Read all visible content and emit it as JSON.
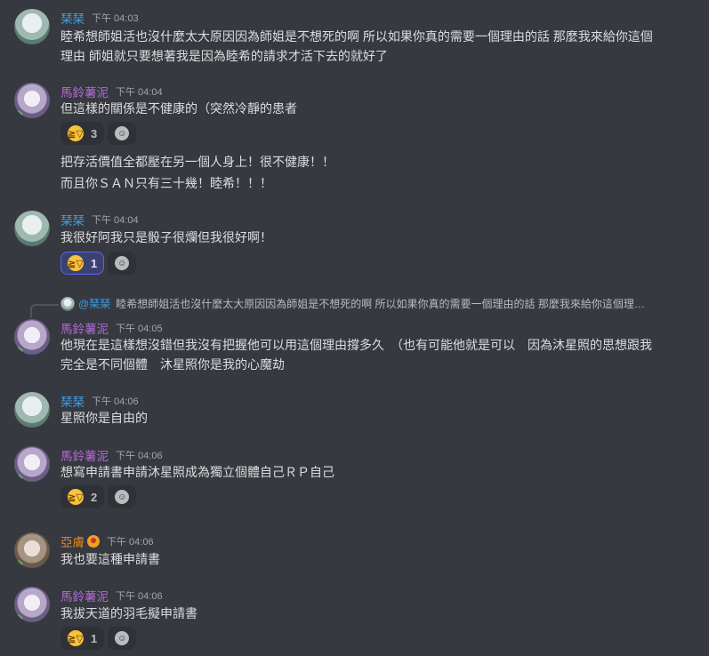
{
  "messages": [
    {
      "author": "琹琹",
      "time": "下午 04:03",
      "lines": [
        "睦希想師姐活也沒什麼太大原因因為師姐是不想死的啊 所以如果你真的需要一個理由的話 那麼我來給你這個",
        "理由 師姐就只要想著我是因為睦希的請求才活下去的就好了"
      ]
    },
    {
      "author": "馬鈴薯泥",
      "time": "下午 04:04",
      "lines": [
        "但這樣的關係是不健康的（突然冷靜的患者"
      ],
      "reaction_count": "3",
      "extra_lines": [
        "把存活價值全都壓在另一個人身上！很不健康！！",
        "而且你ＳＡＮ只有三十幾！睦希！！！"
      ]
    },
    {
      "author": "琹琹",
      "time": "下午 04:04",
      "lines": [
        "我很好阿我只是骰子很爛但我很好啊！"
      ],
      "reaction_count": "1"
    },
    {
      "reply": {
        "name": "@琹琹",
        "text": "睦希想師姐活也沒什麼太大原因因為師姐是不想死的啊 所以如果你真的需要一個理由的話 那麼我來給你這個理…"
      },
      "author": "馬鈴薯泥",
      "time": "下午 04:05",
      "lines": [
        "他現在是這樣想沒錯但我沒有把握他可以用這個理由撐多久　（也有可能他就是可以　因為沐星照的思想跟我",
        "完全是不同個體　沐星照你是我的心魔劫"
      ]
    },
    {
      "author": "琹琹",
      "time": "下午 04:06",
      "lines": [
        "星照你是自由的"
      ]
    },
    {
      "author": "馬鈴薯泥",
      "time": "下午 04:06",
      "lines": [
        "想寫申請書申請沐星照成為獨立個體自己ＲＰ自己"
      ],
      "reaction_count": "2"
    },
    {
      "author": "亞膚",
      "time": "下午 04:06",
      "lines": [
        "我也要這種申請書"
      ]
    },
    {
      "author": "馬鈴薯泥",
      "time": "下午 04:06",
      "lines": [
        "我拔天道的羽毛擬申請書"
      ],
      "reaction_count": "1"
    }
  ],
  "icons": {
    "reaction_emoji": "grinning-squinting-face-icon",
    "add_reaction": "add-reaction-icon",
    "badge": "role-badge-icon"
  },
  "colors": {
    "background": "#36393f",
    "name_blue": "#3ba0e6",
    "name_purple": "#b36ad6",
    "name_orange": "#e68b20",
    "active_reaction_border": "#5865f2"
  }
}
